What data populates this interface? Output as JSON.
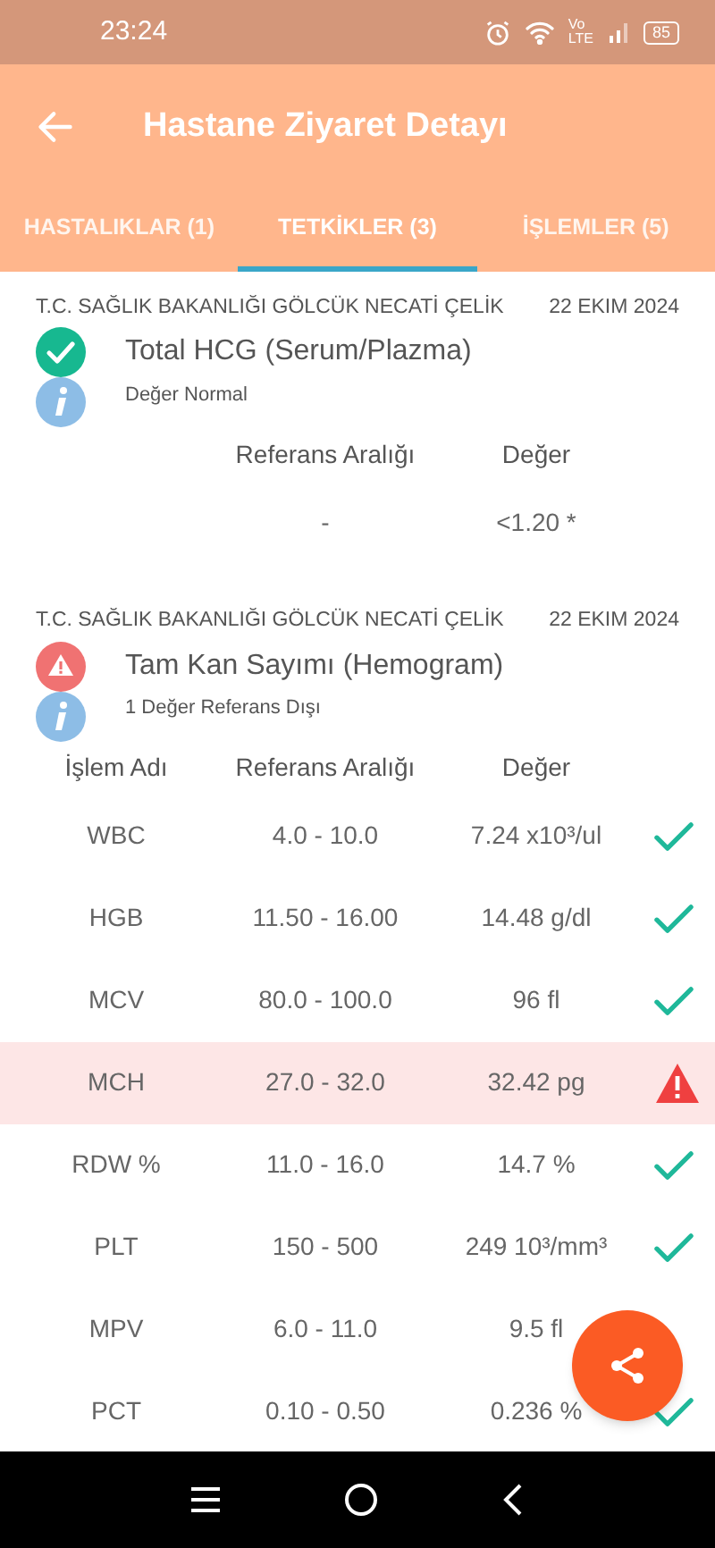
{
  "status_bar": {
    "time": "23:24",
    "network_top": "Vo",
    "network_bottom": "LTE",
    "battery": "85"
  },
  "toolbar": {
    "title": "Hastane Ziyaret Detayı"
  },
  "tabs": [
    {
      "label": "HASTALIKLAR (1)",
      "selected": false
    },
    {
      "label": "TETKİKLER (3)",
      "selected": true
    },
    {
      "label": "İŞLEMLER (5)",
      "selected": false
    }
  ],
  "tests": [
    {
      "hospital": "T.C. SAĞLIK BAKANLIĞI GÖLCÜK NECATİ ÇELİK",
      "date": "22 EKIM 2024",
      "name": "Total HCG (Serum/Plazma)",
      "kind": "normal",
      "note": "Değer Normal",
      "columns": [
        "Referans Aralığı",
        "Değer"
      ],
      "rows": [
        {
          "range": "-",
          "value": "<1.20 *"
        }
      ]
    },
    {
      "hospital": "T.C. SAĞLIK BAKANLIĞI GÖLCÜK NECATİ ÇELİK",
      "date": "22 EKIM 2024",
      "name": "Tam Kan Sayımı (Hemogram)",
      "kind": "warning",
      "note": "1 Değer Referans Dışı",
      "columns": [
        "İşlem Adı",
        "Referans Aralığı",
        "Değer"
      ],
      "rows": [
        {
          "kind": "normal",
          "name": "WBC",
          "range": "4.0 - 10.0",
          "value": "7.24 x10³/ul"
        },
        {
          "kind": "normal",
          "name": "HGB",
          "range": "11.50 - 16.00",
          "value": "14.48 g/dl"
        },
        {
          "kind": "normal",
          "name": "MCV",
          "range": "80.0 - 100.0",
          "value": "96 fl"
        },
        {
          "kind": "abnormal",
          "name": "MCH",
          "range": "27.0 - 32.0",
          "value": "32.42 pg"
        },
        {
          "kind": "normal",
          "name": "RDW %",
          "range": "11.0 - 16.0",
          "value": "14.7 %"
        },
        {
          "kind": "normal",
          "name": "PLT",
          "range": "150 - 500",
          "value": "249 10³/mm³"
        },
        {
          "name": "MPV",
          "range": "6.0 - 11.0",
          "value": "9.5 fl"
        },
        {
          "kind": "normal",
          "name": "PCT",
          "range": "0.10 - 0.50",
          "value": "0.236 %"
        }
      ]
    }
  ]
}
